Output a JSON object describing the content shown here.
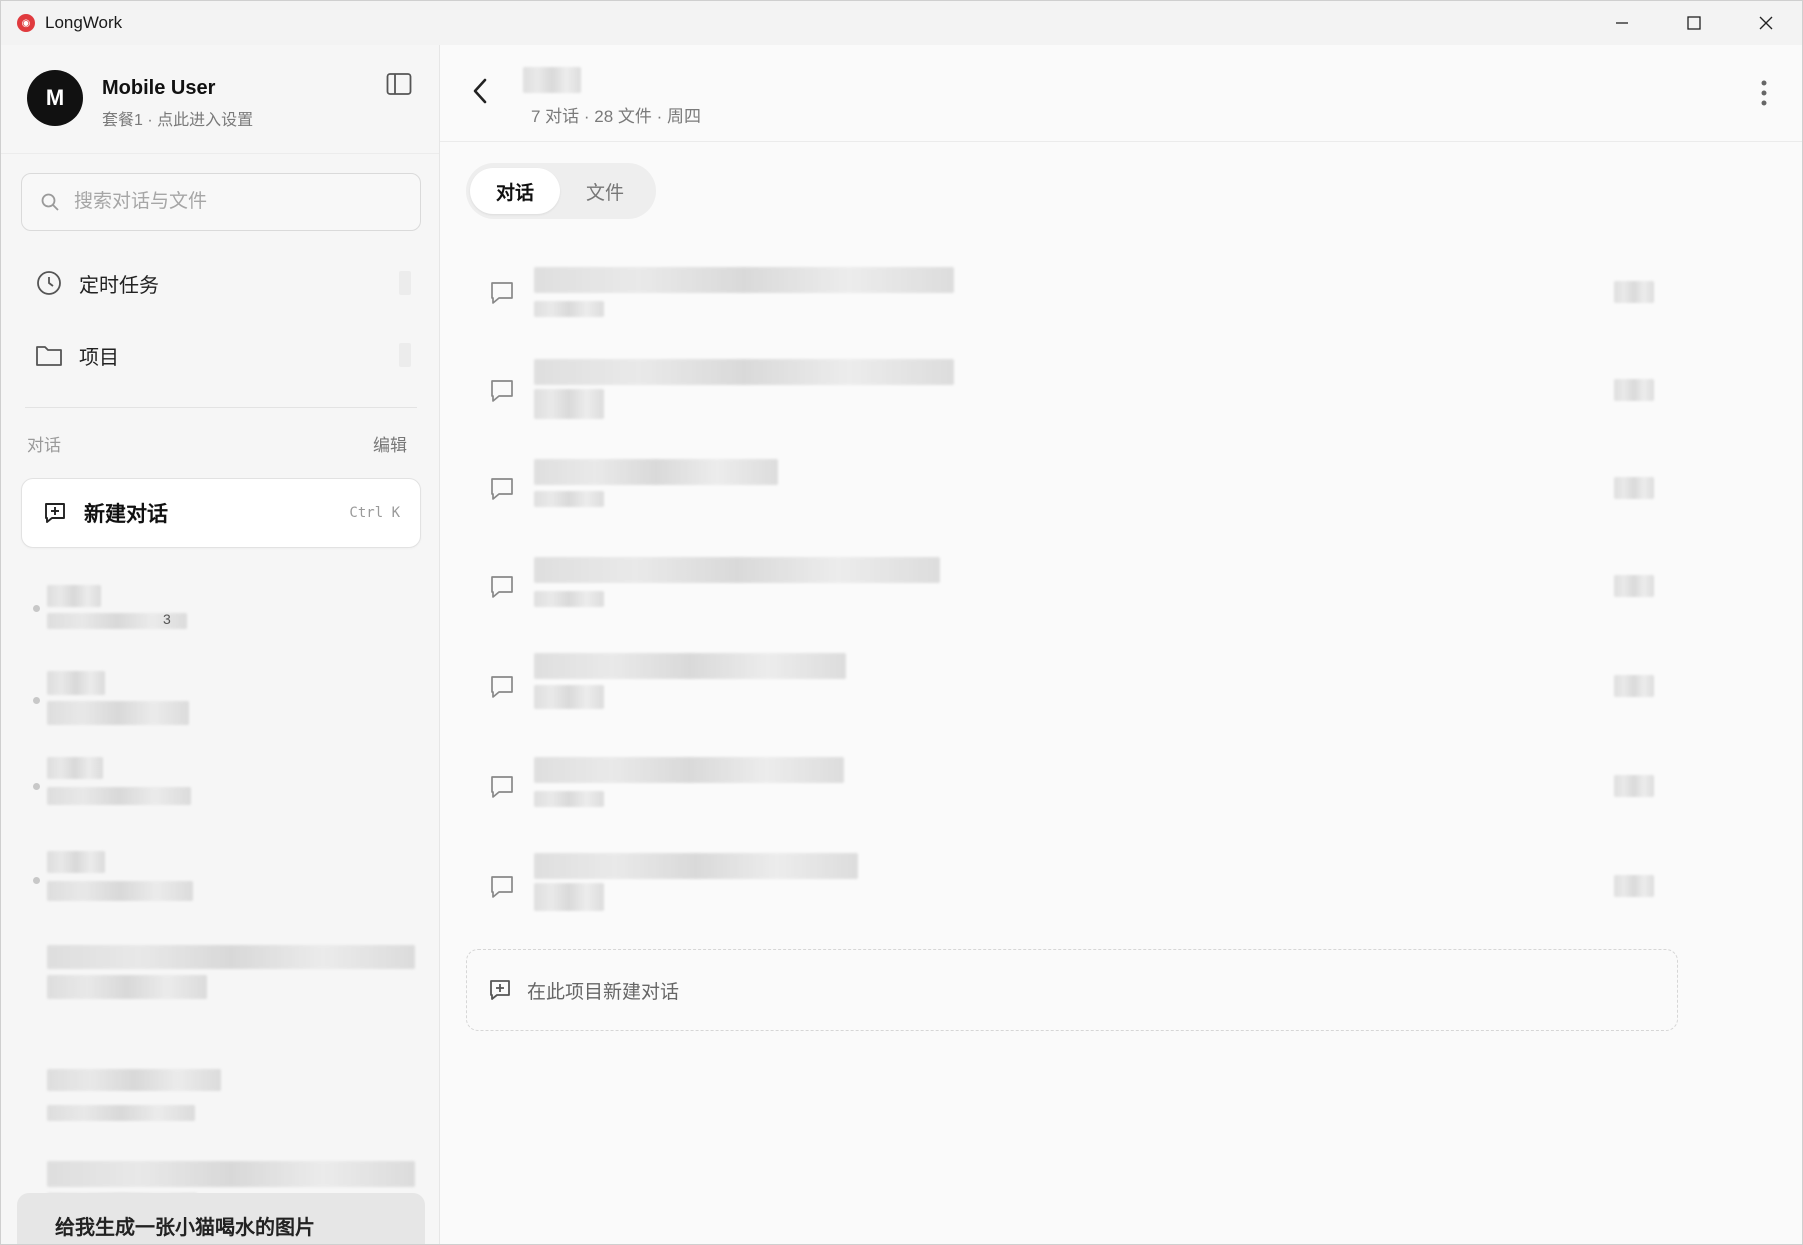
{
  "window": {
    "title": "LongWork"
  },
  "profile": {
    "avatar_initial": "M",
    "name": "Mobile User",
    "subtitle": "套餐1 · 点此进入设置"
  },
  "search": {
    "placeholder": "搜索对话与文件"
  },
  "nav": [
    {
      "label": "定时任务",
      "icon": "clock-icon"
    },
    {
      "label": "项目",
      "icon": "folder-icon"
    }
  ],
  "conversations_section": {
    "label": "对话",
    "edit_label": "编辑"
  },
  "new_chat": {
    "label": "新建对话",
    "shortcut": "Ctrl K"
  },
  "sidebar_conversations": [
    {
      "suffix": "3"
    },
    {
      "suffix": ""
    },
    {
      "suffix": ""
    },
    {
      "suffix": ""
    },
    {
      "suffix": ""
    },
    {
      "suffix": ""
    },
    {
      "suffix": ""
    }
  ],
  "bottom_prompt": {
    "text": "给我生成一张小猫喝水的图片"
  },
  "project": {
    "subtitle": "7 对话 · 28 文件 · 周四"
  },
  "tabs": [
    {
      "label": "对话",
      "active": true
    },
    {
      "label": "文件",
      "active": false
    }
  ],
  "new_in_project": {
    "label": "在此项目新建对话"
  },
  "colors": {
    "accent_dark": "#111111",
    "logo_red": "#e03a3e"
  }
}
